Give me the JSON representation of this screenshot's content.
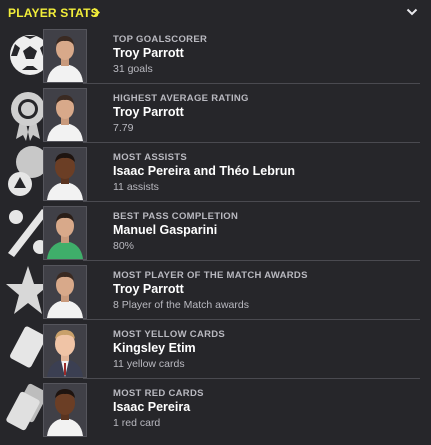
{
  "header": {
    "title": "PLAYER STATS"
  },
  "colors": {
    "accent": "#f2ee3a",
    "background": "#26262a",
    "muted": "#b9b9c0"
  },
  "stats": [
    {
      "category": "TOP GOALSCORER",
      "player": "Troy Parrott",
      "value": "31 goals",
      "icon": "football-icon",
      "portrait": "kit-white"
    },
    {
      "category": "HIGHEST AVERAGE RATING",
      "player": "Troy Parrott",
      "value": "7.79",
      "icon": "rosette-icon",
      "portrait": "kit-white"
    },
    {
      "category": "MOST ASSISTS",
      "player": "Isaac Pereira and Théo Lebrun",
      "value": "11 assists",
      "icon": "assist-icon",
      "portrait": "kit-white-dark"
    },
    {
      "category": "BEST PASS COMPLETION",
      "player": "Manuel Gasparini",
      "value": "80%",
      "icon": "percent-icon",
      "portrait": "kit-green"
    },
    {
      "category": "MOST PLAYER OF THE MATCH AWARDS",
      "player": "Troy Parrott",
      "value": "8 Player of the Match awards",
      "icon": "star-icon",
      "portrait": "kit-white"
    },
    {
      "category": "MOST YELLOW CARDS",
      "player": "Kingsley Etim",
      "value": "11 yellow cards",
      "icon": "yellow-card-icon",
      "portrait": "suit"
    },
    {
      "category": "MOST RED CARDS",
      "player": "Isaac Pereira",
      "value": "1 red card",
      "icon": "red-card-icon",
      "portrait": "kit-white-dark"
    }
  ]
}
